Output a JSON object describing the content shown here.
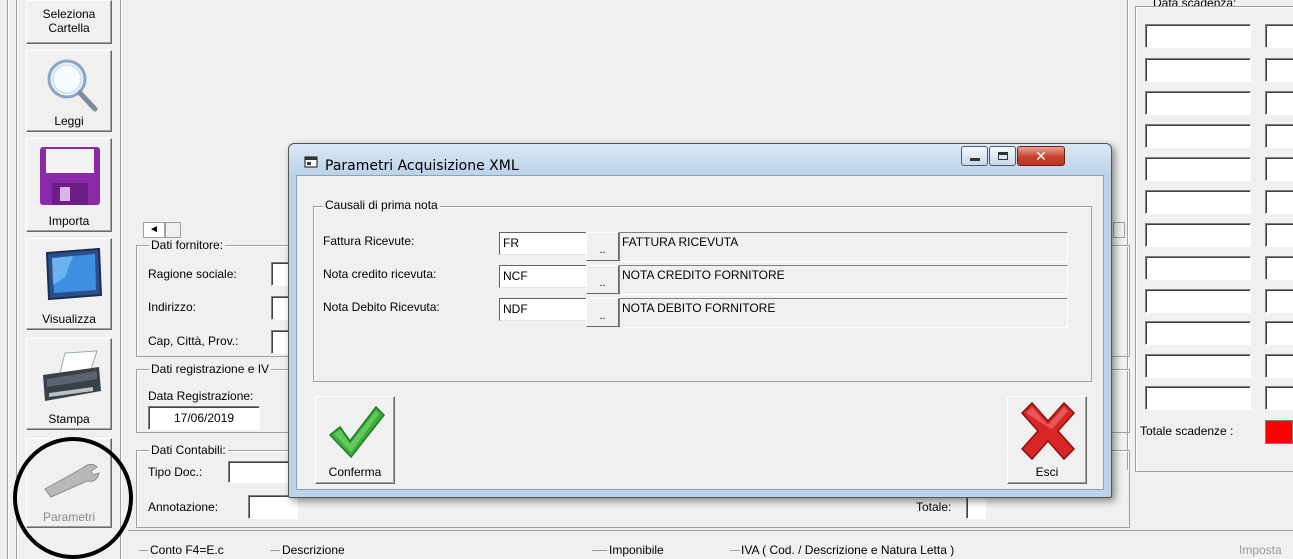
{
  "toolbar": {
    "select_folder_line1": "Seleziona",
    "select_folder_line2": "Cartella",
    "read": "Leggi",
    "import": "Importa",
    "view": "Visualizza",
    "print": "Stampa",
    "parameters": "Parametri"
  },
  "supplier": {
    "group_title": "Dati fornitore:",
    "company_label": "Ragione sociale:",
    "address_label": "Indirizzo:",
    "city_label": "Cap, Città, Prov.:"
  },
  "registration": {
    "group_title": "Dati registrazione e IV",
    "date_label": "Data Registrazione:",
    "date_value": "17/06/2019"
  },
  "accounting": {
    "group_title": "Dati Contabili:",
    "doc_type_label": "Tipo Doc.:",
    "note_label": "Annotazione:",
    "total_label": "Totale:"
  },
  "grid_headers": {
    "account": "Conto F4=E.c",
    "description": "Descrizione",
    "taxable": "Imponibile",
    "vat": "IVA ( Cod. / Descrizione e Natura Letta )",
    "tax": "Imposta"
  },
  "right_panel": {
    "due_date_label": "Data scadenza:",
    "total_due_label": "Totale scadenze :",
    "total_due_color": "#ff0000"
  },
  "dialog": {
    "title": "Parametri Acquisizione XML",
    "group_title": "Causali di prima nota",
    "rows": [
      {
        "label": "Fattura Ricevute:",
        "code": "FR",
        "lookup": "..",
        "description": "FATTURA RICEVUTA"
      },
      {
        "label": "Nota credito ricevuta:",
        "code": "NCF",
        "lookup": "..",
        "description": "NOTA CREDITO FORNITORE"
      },
      {
        "label": "Nota Debito Ricevuta:",
        "code": "NDF",
        "lookup": "..",
        "description": "NOTA DEBITO FORNITORE"
      }
    ],
    "confirm": "Conferma",
    "exit": "Esci"
  },
  "icons": {
    "read": "magnifier-icon",
    "import": "floppy-disk-icon",
    "view": "monitor-icon",
    "print": "printer-icon",
    "parameters": "wrench-icon",
    "confirm": "checkmark-icon",
    "exit": "red-x-icon"
  }
}
